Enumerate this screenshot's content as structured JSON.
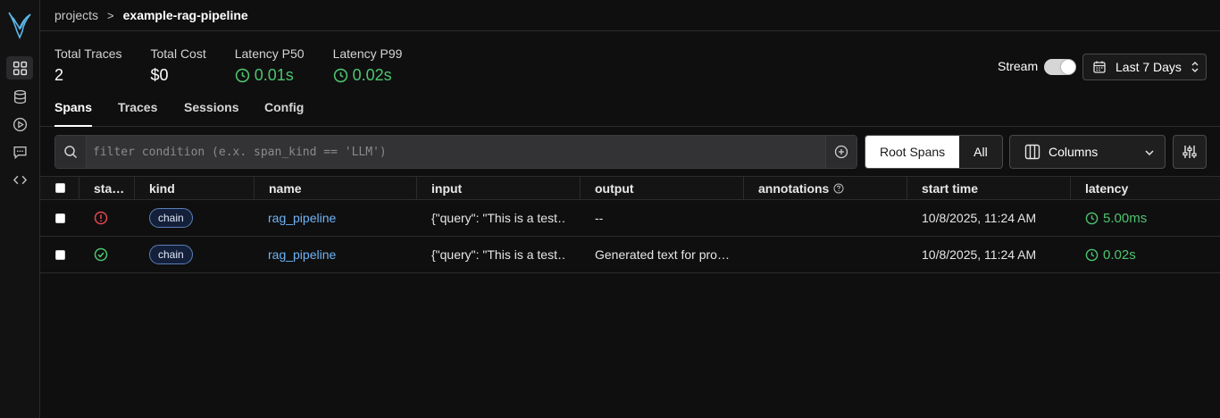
{
  "breadcrumb": {
    "root": "projects",
    "separator": ">",
    "current": "example-rag-pipeline"
  },
  "stats": {
    "total_traces_label": "Total Traces",
    "total_traces_value": "2",
    "total_cost_label": "Total Cost",
    "total_cost_value": "$0",
    "p50_label": "Latency P50",
    "p50_value": "0.01s",
    "p99_label": "Latency P99",
    "p99_value": "0.02s"
  },
  "stream": {
    "label": "Stream",
    "enabled": true
  },
  "time_range": {
    "label": "Last 7 Days"
  },
  "tabs": [
    "Spans",
    "Traces",
    "Sessions",
    "Config"
  ],
  "active_tab": "Spans",
  "filter": {
    "placeholder": "filter condition (e.x. span_kind == 'LLM')"
  },
  "span_scope": {
    "options": [
      "Root Spans",
      "All"
    ],
    "selected": "Root Spans"
  },
  "columns_button": {
    "label": "Columns"
  },
  "table": {
    "headers": {
      "status": "sta…",
      "kind": "kind",
      "name": "name",
      "input": "input",
      "output": "output",
      "annotations": "annotations",
      "start_time": "start time",
      "latency": "latency"
    },
    "rows": [
      {
        "status": "error",
        "kind": "chain",
        "name": "rag_pipeline",
        "input": "{\"query\": \"This is a test…",
        "output": "--",
        "annotations": "",
        "start_time": "10/8/2025, 11:24 AM",
        "latency": "5.00ms"
      },
      {
        "status": "ok",
        "kind": "chain",
        "name": "rag_pipeline",
        "input": "{\"query\": \"This is a test…",
        "output": "Generated text for pro…",
        "annotations": "",
        "start_time": "10/8/2025, 11:24 AM",
        "latency": "0.02s"
      }
    ]
  },
  "colors": {
    "accent_green": "#4ec46e",
    "error_red": "#e5484d",
    "link_blue": "#6fb3f2",
    "logo_blue": "#5ab8e8"
  },
  "icons": {
    "rail": [
      "grid-icon",
      "database-icon",
      "play-circle-icon",
      "message-icon",
      "code-icon"
    ],
    "latency": "clock-icon",
    "date": "calendar-icon",
    "search": "search-icon",
    "add": "plus-circle-icon",
    "columns": "columns-icon",
    "settings": "sliders-icon",
    "help": "help-circle-icon"
  }
}
